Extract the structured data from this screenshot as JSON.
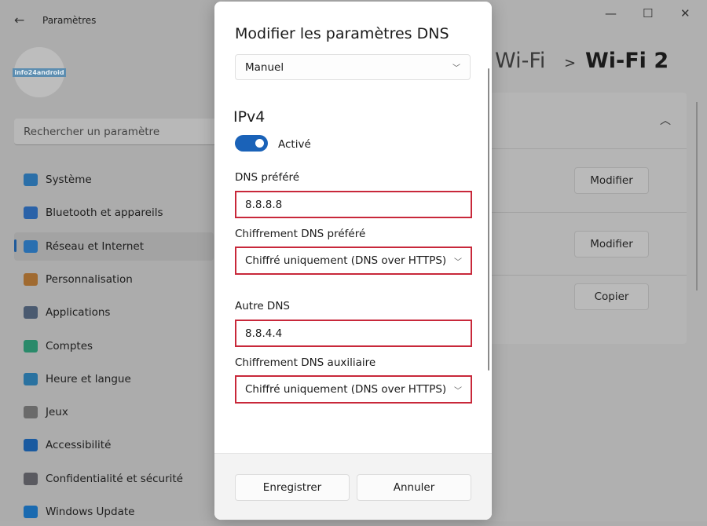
{
  "window": {
    "title": "Paramètres",
    "controls": [
      "—",
      "☐",
      "✕"
    ]
  },
  "profile": {
    "logo_text": "info24android"
  },
  "search": {
    "placeholder": "Rechercher un paramètre"
  },
  "sidebar": {
    "items": [
      {
        "label": "Système",
        "icon": "monitor-icon",
        "color": "#2b6fa8"
      },
      {
        "label": "Bluetooth et appareils",
        "icon": "bluetooth-icon",
        "color": "#2a62a8"
      },
      {
        "label": "Réseau et Internet",
        "icon": "wifi-icon",
        "color": "#2a6fb0",
        "selected": true
      },
      {
        "label": "Personnalisation",
        "icon": "brush-icon",
        "color": "#a06a30"
      },
      {
        "label": "Applications",
        "icon": "apps-icon",
        "color": "#4a5a70"
      },
      {
        "label": "Comptes",
        "icon": "person-icon",
        "color": "#2a8a6a"
      },
      {
        "label": "Heure et langue",
        "icon": "clock-globe-icon",
        "color": "#2a72a0"
      },
      {
        "label": "Jeux",
        "icon": "gamepad-icon",
        "color": "#6a6a6a"
      },
      {
        "label": "Accessibilité",
        "icon": "accessibility-icon",
        "color": "#1a5aa0"
      },
      {
        "label": "Confidentialité et sécurité",
        "icon": "shield-icon",
        "color": "#5a5a60"
      },
      {
        "label": "Windows Update",
        "icon": "update-icon",
        "color": "#1a6ab0"
      }
    ]
  },
  "breadcrumb": {
    "parent": "Wi-Fi",
    "separator": ">",
    "current": "Wi-Fi 2"
  },
  "panel": {
    "buttons": [
      "Modifier",
      "Modifier",
      "Copier"
    ]
  },
  "dialog": {
    "title": "Modifier les paramètres DNS",
    "mode": "Manuel",
    "section": "IPv4",
    "toggle": {
      "label": "Activé",
      "on": true
    },
    "preferred_dns": {
      "label": "DNS préféré",
      "value": "8.8.8.8"
    },
    "preferred_encryption": {
      "label": "Chiffrement DNS préféré",
      "value": "Chiffré uniquement (DNS over HTTPS)"
    },
    "alternate_dns": {
      "label": "Autre DNS",
      "value": "8.8.4.4"
    },
    "alternate_encryption": {
      "label": "Chiffrement DNS auxiliaire",
      "value": "Chiffré uniquement (DNS over HTTPS)"
    },
    "save": "Enregistrer",
    "cancel": "Annuler"
  },
  "colors": {
    "accent": "#1a62b8",
    "highlight_border": "#c8283a"
  }
}
